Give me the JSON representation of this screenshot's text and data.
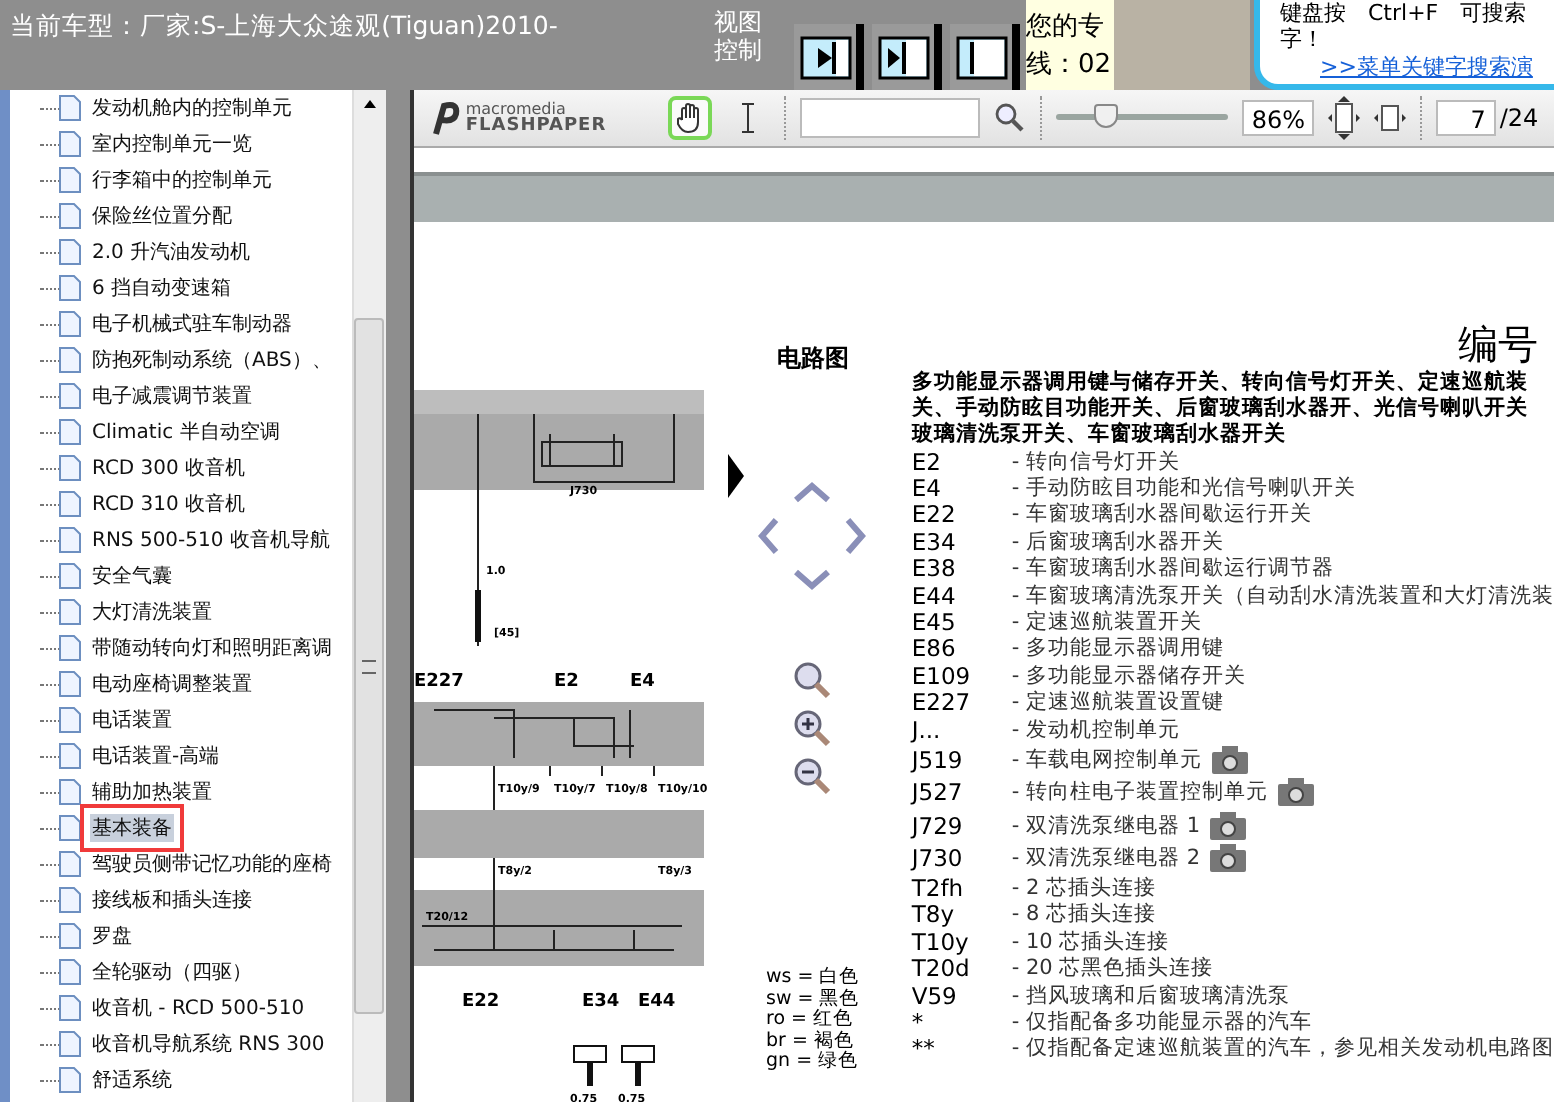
{
  "header": {
    "title": "当前车型：厂家:S-上海大众途观(Tiguan)2010-",
    "view_label": [
      "视图",
      "控制"
    ],
    "view_buttons": [
      {
        "kind": "right"
      },
      {
        "kind": "both"
      },
      {
        "kind": "left"
      }
    ],
    "hotline": [
      "您的专",
      "线：02"
    ],
    "tip": {
      "line_1": "键盘按　Ctrl+F　可搜索",
      "line_2": "字！",
      "link": ">>菜单关键字搜索演"
    }
  },
  "tree": {
    "items": [
      {
        "label": "发动机舱内的控制单元",
        "selected": false
      },
      {
        "label": "室内控制单元一览",
        "selected": false
      },
      {
        "label": "行李箱中的控制单元",
        "selected": false
      },
      {
        "label": "保险丝位置分配",
        "selected": false
      },
      {
        "label": "2.0 升汽油发动机",
        "selected": false
      },
      {
        "label": "6 挡自动变速箱",
        "selected": false
      },
      {
        "label": "电子机械式驻车制动器",
        "selected": false
      },
      {
        "label": "防抱死制动系统（ABS）、",
        "selected": false
      },
      {
        "label": "电子减震调节装置",
        "selected": false
      },
      {
        "label": "Climatic 半自动空调",
        "selected": false
      },
      {
        "label": "RCD 300 收音机",
        "selected": false
      },
      {
        "label": "RCD 310 收音机",
        "selected": false
      },
      {
        "label": "RNS 500-510 收音机导航",
        "selected": false
      },
      {
        "label": "安全气囊",
        "selected": false
      },
      {
        "label": "大灯清洗装置",
        "selected": false
      },
      {
        "label": "带随动转向灯和照明距离调",
        "selected": false
      },
      {
        "label": "电动座椅调整装置",
        "selected": false
      },
      {
        "label": "电话装置",
        "selected": false
      },
      {
        "label": "电话装置-高端",
        "selected": false
      },
      {
        "label": "辅助加热装置",
        "selected": false
      },
      {
        "label": "基本装备",
        "selected": true
      },
      {
        "label": "驾驶员侧带记忆功能的座椅",
        "selected": false
      },
      {
        "label": "接线板和插头连接",
        "selected": false
      },
      {
        "label": "罗盘",
        "selected": false
      },
      {
        "label": "全轮驱动（四驱）",
        "selected": false
      },
      {
        "label": "收音机 - RCD 500-510",
        "selected": false
      },
      {
        "label": "收音机导航系统 RNS 300",
        "selected": false
      },
      {
        "label": "舒适系统",
        "selected": false
      }
    ]
  },
  "toolbar": {
    "logo_top": "macromedia",
    "logo_bottom": "FLASHPAPER",
    "tools": [
      {
        "kind": "hand",
        "selected": true
      },
      {
        "kind": "text",
        "selected": false
      }
    ],
    "zoom": {
      "level": 0.29,
      "value": "86%"
    },
    "page": {
      "value": "7",
      "total": "/24"
    }
  },
  "document": {
    "section_title": "电路图",
    "number_title": "编号",
    "diagram_labels": [
      "1.0",
      "[45]",
      "J730",
      "E227",
      "E2",
      "E4",
      "T10y/9",
      "T10y/7",
      "T10y/8",
      "T10y/10",
      "T8y/2",
      "T8y/3",
      "T20/12",
      "E22",
      "E34",
      "E44",
      "0.75",
      "0.75"
    ],
    "description": [
      "多功能显示器调用键与储存开关、转向信号灯开关、定速巡航装",
      "关、手动防眩目功能开关、后窗玻璃刮水器开、光信号喇叭开关",
      "玻璃清洗泵开关、车窗玻璃刮水器开关"
    ],
    "legend": [
      {
        "code": "ws",
        "meaning": "= 白色"
      },
      {
        "code": "sw",
        "meaning": "= 黑色"
      },
      {
        "code": "ro",
        "meaning": "= 红色"
      },
      {
        "code": "br",
        "meaning": "= 褐色"
      },
      {
        "code": "gn",
        "meaning": "= 绿色"
      }
    ],
    "entries": [
      {
        "code": "E2",
        "text": "-  转向信号灯开关",
        "photo": false
      },
      {
        "code": "E4",
        "text": "-  手动防眩目功能和光信号喇叭开关",
        "photo": false
      },
      {
        "code": "E22",
        "text": "-  车窗玻璃刮水器间歇运行开关",
        "photo": false
      },
      {
        "code": "E34",
        "text": "-  后窗玻璃刮水器开关",
        "photo": false
      },
      {
        "code": "E38",
        "text": "-  车窗玻璃刮水器间歇运行调节器",
        "photo": false
      },
      {
        "code": "E44",
        "text": "-  车窗玻璃清洗泵开关（自动刮水清洗装置和大灯清洗装",
        "photo": false
      },
      {
        "code": "E45",
        "text": "-  定速巡航装置开关",
        "photo": false
      },
      {
        "code": "E86",
        "text": "-  多功能显示器调用键",
        "photo": false
      },
      {
        "code": "E109",
        "text": "-  多功能显示器储存开关",
        "photo": false
      },
      {
        "code": "E227",
        "text": "-  定速巡航装置设置键",
        "photo": false
      },
      {
        "code": "J...",
        "text": "-  发动机控制单元",
        "photo": false
      },
      {
        "code": "J519",
        "text": "-  车载电网控制单元",
        "photo": true
      },
      {
        "code": "J527",
        "text": "-  转向柱电子装置控制单元",
        "photo": true
      },
      {
        "code": "J729",
        "text": "-  双清洗泵继电器 1",
        "photo": true
      },
      {
        "code": "J730",
        "text": "-  双清洗泵继电器 2",
        "photo": true
      },
      {
        "code": "T2fh",
        "text": "-  2 芯插头连接",
        "photo": false
      },
      {
        "code": "T8y",
        "text": "-  8 芯插头连接",
        "photo": false
      },
      {
        "code": "T10y",
        "text": "-  10 芯插头连接",
        "photo": false
      },
      {
        "code": "T20d",
        "text": "-  20 芯黑色插头连接",
        "photo": false
      },
      {
        "code": "V59",
        "text": "-  挡风玻璃和后窗玻璃清洗泵",
        "photo": false
      },
      {
        "code": "*",
        "text": "-  仅指配备多功能显示器的汽车",
        "photo": false
      },
      {
        "code": "**",
        "text": "-  仅指配备定速巡航装置的汽车，参见相关发动机电路图",
        "photo": false
      }
    ]
  }
}
